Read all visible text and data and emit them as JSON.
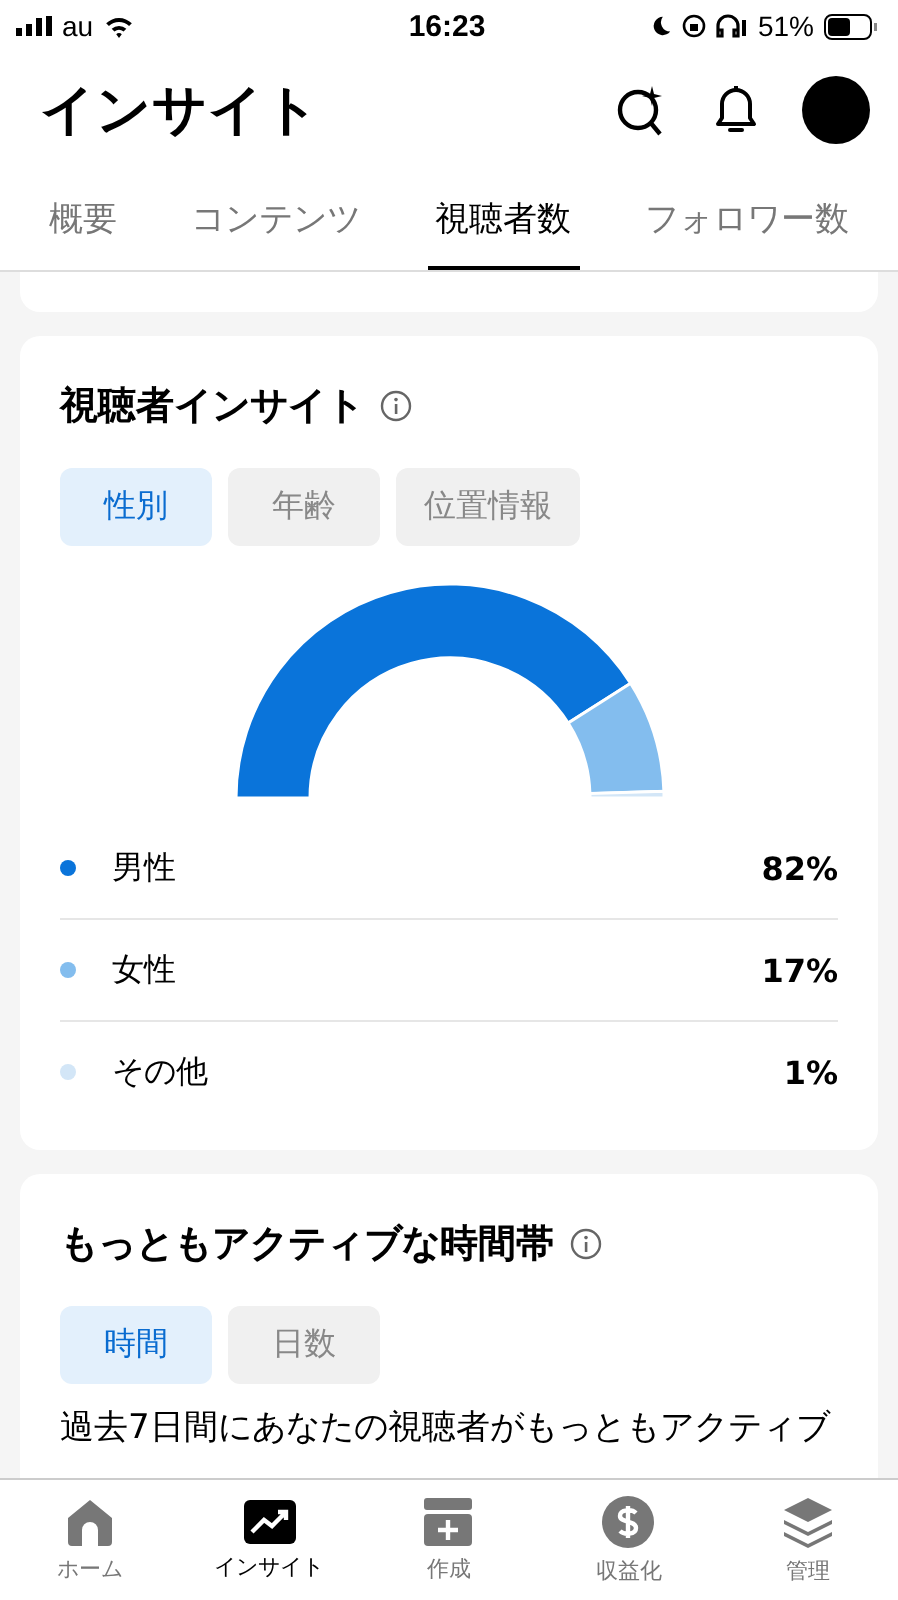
{
  "status_bar": {
    "carrier": "au",
    "time": "16:23",
    "battery": "51%"
  },
  "header": {
    "title": "インサイト"
  },
  "tabs": [
    {
      "label": "概要",
      "selected": false
    },
    {
      "label": "コンテンツ",
      "selected": false
    },
    {
      "label": "視聴者数",
      "selected": true
    },
    {
      "label": "フォロワー数",
      "selected": false
    }
  ],
  "audience_card": {
    "title": "視聴者インサイト",
    "filters": [
      {
        "label": "性別",
        "selected": true
      },
      {
        "label": "年齢",
        "selected": false
      },
      {
        "label": "位置情報",
        "selected": false
      }
    ],
    "chart_data": {
      "type": "donut",
      "categories": [
        "男性",
        "女性",
        "その他"
      ],
      "values": [
        82,
        17,
        1
      ]
    },
    "legend": [
      {
        "value": "82%",
        "color": "#0a74da"
      },
      {
        "value": "17%",
        "color": "#83bdee"
      },
      {
        "value": "1%",
        "color": "#d3e6f7"
      }
    ]
  },
  "active_card": {
    "title": "もっともアクティブな時間帯",
    "filters": [
      {
        "label": "時間",
        "selected": true
      },
      {
        "label": "日数",
        "selected": false
      }
    ],
    "description": "過去7日間にあなたの視聴者がもっともアクティブ"
  },
  "bottom_nav": [
    {
      "label": "ホーム",
      "selected": false,
      "kind": "home"
    },
    {
      "label": "インサイト",
      "selected": true,
      "kind": "insights"
    },
    {
      "label": "作成",
      "selected": false,
      "kind": "create"
    },
    {
      "label": "収益化",
      "selected": false,
      "kind": "money"
    },
    {
      "label": "管理",
      "selected": false,
      "kind": "layers"
    }
  ]
}
